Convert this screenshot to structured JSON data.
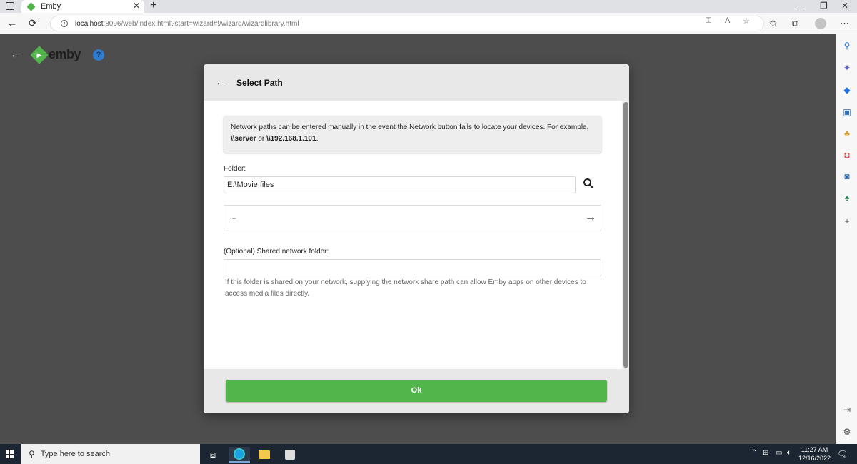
{
  "browser": {
    "tab_title": "Emby",
    "tab_close": "✕",
    "new_tab": "+",
    "url_host": "localhost",
    "url_rest": ":8096/web/index.html?start=wizard#!/wizard/wizardlibrary.html"
  },
  "emby": {
    "logo_text": "emby",
    "help_glyph": "?"
  },
  "dialog": {
    "title": "Select Path",
    "note_pre": "Network paths can be entered manually in the event the Network button fails to locate your devices. For example, ",
    "note_server": "\\\\server",
    "note_or": " or ",
    "note_ip": "\\\\192.168.1.101",
    "note_end": ".",
    "folder_label": "Folder:",
    "folder_value": "E:\\Movie files",
    "dir_item": "...",
    "share_label": "(Optional) Shared network folder:",
    "share_value": "",
    "helper_text": "If this folder is shared on your network, supplying the network share path can allow Emby apps on other devices to access media files directly.",
    "ok_label": "Ok"
  },
  "taskbar": {
    "search_placeholder": "Type here to search",
    "time": "11:27 AM",
    "date": "12/16/2022"
  },
  "colors": {
    "accent": "#52b54b",
    "page_bg": "#4d4d4d"
  }
}
